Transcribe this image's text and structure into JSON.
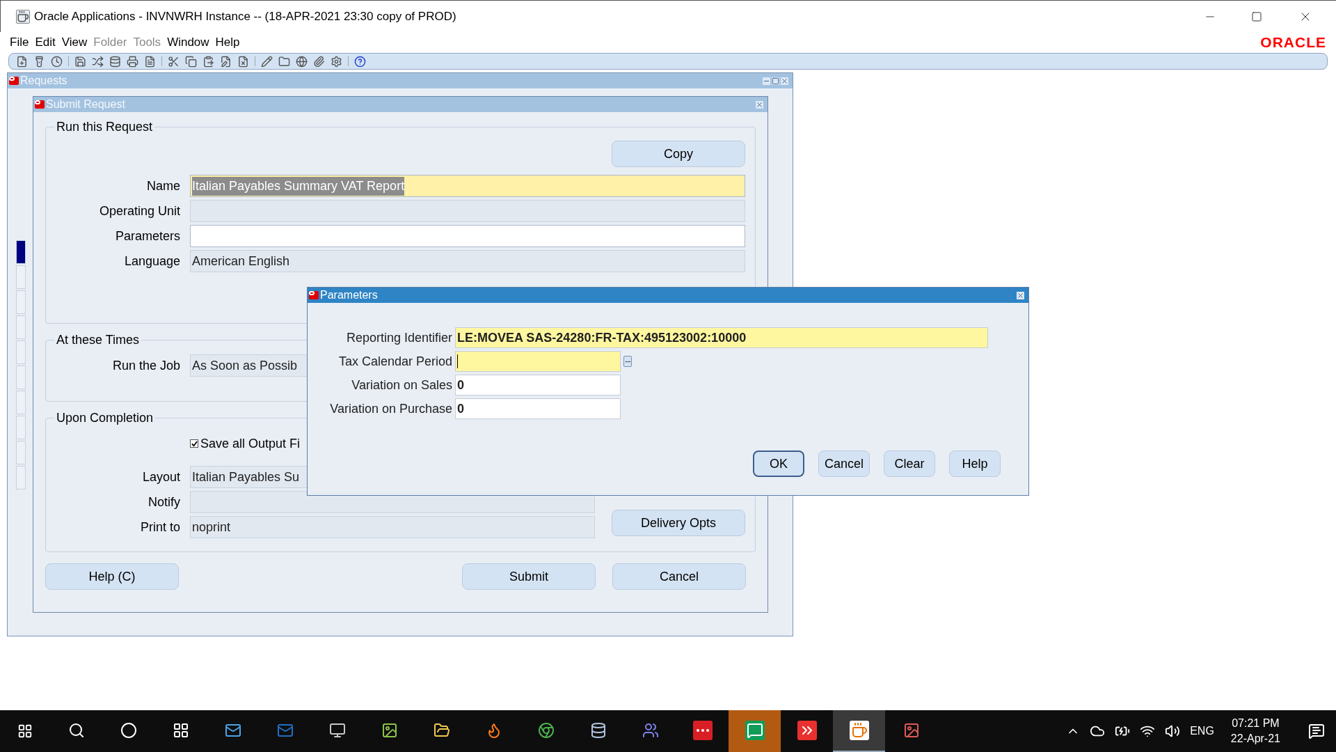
{
  "window": {
    "title": "Oracle Applications - INVNWRH Instance -- (18-APR-2021 23:30 copy of PROD)",
    "logo": "ORACLE"
  },
  "menu": [
    {
      "label": "File",
      "disabled": false
    },
    {
      "label": "Edit",
      "disabled": false
    },
    {
      "label": "View",
      "disabled": false
    },
    {
      "label": "Folder",
      "disabled": true
    },
    {
      "label": "Tools",
      "disabled": true
    },
    {
      "label": "Window",
      "disabled": false
    },
    {
      "label": "Help",
      "disabled": false
    }
  ],
  "requests_window": {
    "title": "Requests",
    "active": false
  },
  "submit_window": {
    "title": "Submit Request",
    "active": false,
    "run_group": {
      "title": "Run this Request",
      "copy_button": "Copy",
      "fields": [
        {
          "label": "Name",
          "value": "Italian Payables Summary VAT Report",
          "required": true,
          "readonly": false,
          "text_selected": true
        },
        {
          "label": "Operating Unit",
          "required": false,
          "readonly": true
        },
        {
          "label": "Parameters",
          "required": false,
          "readonly": false
        },
        {
          "label": "Language",
          "value": "American English",
          "required": false,
          "readonly": true,
          "text_selected": false
        }
      ]
    },
    "times_group": {
      "title": "At these Times",
      "fields": [
        {
          "label": "Run the Job",
          "value": "As Soon as Possib",
          "required": false,
          "readonly": true
        }
      ]
    },
    "completion_group": {
      "title": "Upon Completion",
      "checkbox": {
        "label": "Save all Output Fi",
        "checked": true
      },
      "fields": [
        {
          "label": "Layout",
          "value": "Italian Payables Su",
          "required": false,
          "readonly": true
        },
        {
          "label": "Notify",
          "required": false,
          "readonly": true
        },
        {
          "label": "Print to",
          "value": "noprint",
          "required": false,
          "readonly": true
        }
      ],
      "delivery_button": "Delivery Opts"
    },
    "buttons": [
      "Help (C)",
      "Submit",
      "Cancel"
    ]
  },
  "parameters_window": {
    "title": "Parameters",
    "active": true,
    "fields": [
      {
        "label": "Reporting Identifier",
        "value": "LE:MOVEA SAS-24280:FR-TAX:495123002:10000",
        "required": true,
        "kind": "text",
        "focused": false
      },
      {
        "label": "Tax Calendar Period",
        "required": true,
        "kind": "lov",
        "focused": true
      },
      {
        "label": "Variation on Sales",
        "value": "0",
        "required": false,
        "kind": "short",
        "focused": false
      },
      {
        "label": "Variation on Purchase",
        "value": "0",
        "required": false,
        "kind": "short",
        "focused": false
      }
    ],
    "buttons": [
      {
        "label": "OK",
        "default": true
      },
      {
        "label": "Cancel",
        "default": false
      },
      {
        "label": "Clear",
        "default": false
      },
      {
        "label": "Help",
        "default": false
      }
    ]
  },
  "taskbar": {
    "apps": [
      {
        "selected": false,
        "attention": false
      },
      {
        "selected": false,
        "attention": false
      },
      {
        "selected": false,
        "attention": false
      },
      {
        "selected": false,
        "attention": false
      },
      {
        "selected": false,
        "attention": false
      },
      {
        "selected": false,
        "attention": false
      },
      {
        "selected": false,
        "attention": false
      },
      {
        "selected": false,
        "attention": false
      },
      {
        "selected": false,
        "attention": false
      },
      {
        "selected": false,
        "attention": false
      },
      {
        "selected": false,
        "attention": false
      },
      {
        "selected": false,
        "attention": false
      },
      {
        "selected": false,
        "attention": false
      },
      {
        "selected": false,
        "attention": true
      },
      {
        "selected": false,
        "attention": false
      },
      {
        "selected": true,
        "attention": false
      },
      {
        "selected": false,
        "attention": false
      }
    ],
    "language": "ENG",
    "time": "07:21 PM",
    "date": "22-Apr-21"
  }
}
